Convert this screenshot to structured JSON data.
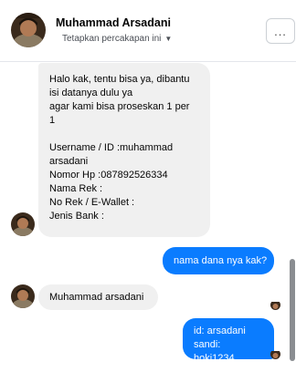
{
  "header": {
    "contact_name": "Muhammad Arsadani",
    "subtitle": "Tetapkan percakapan ini",
    "more_label": "..."
  },
  "messages": [
    {
      "direction": "incoming",
      "text": "Halo kak, tentu bisa ya, dibantu\nisi datanya dulu ya\nagar kami bisa proseskan 1 per\n1\n\nUsername / ID :muhammad\narsadani\nNomor Hp :087892526334\nNama Rek :\nNo Rek / E-Wallet :\nJenis Bank :"
    },
    {
      "direction": "outgoing",
      "text": "nama dana nya kak?"
    },
    {
      "direction": "incoming",
      "text": "Muhammad arsadani"
    },
    {
      "direction": "outgoing",
      "text": "id: arsadani\nsandi: hoki1234"
    }
  ],
  "colors": {
    "outgoing_bubble": "#0a7cff",
    "incoming_bubble": "#f0f0f0",
    "text": "#050505"
  }
}
